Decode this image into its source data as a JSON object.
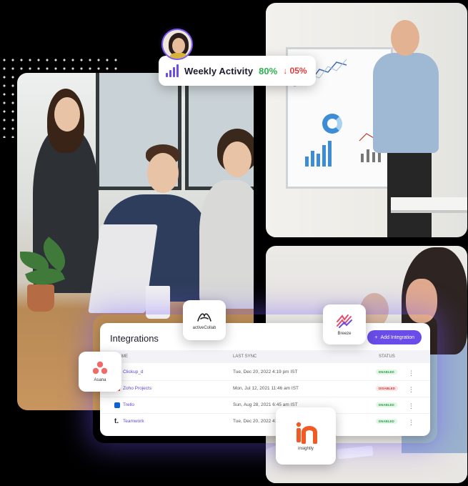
{
  "weekly_activity": {
    "title": "Weekly Activity",
    "percent": "80%",
    "change": "05%",
    "change_icon": "arrow-down-icon"
  },
  "integrations": {
    "title": "Integrations",
    "add_button_label": "Add Integration",
    "columns": [
      "ME",
      "LAST SYNC",
      "STATUS"
    ],
    "rows": [
      {
        "name": "Clickup_d",
        "last_sync": "Tue, Dec 20, 2022 4:19 pm IST",
        "status": "ENABLED"
      },
      {
        "name": "Zoho Projects",
        "last_sync": "Mon, Jul 12, 2021 11:46 am IST",
        "status": "DISABLED"
      },
      {
        "name": "Trello",
        "last_sync": "Sun, Aug 28, 2021 6:45 am IST",
        "status": "ENABLED"
      },
      {
        "name": "Teamwork",
        "last_sync": "Tue, Dec 20, 2022 4:1",
        "status": "ENABLED"
      }
    ]
  },
  "logos": {
    "activecollab": "activeCollab",
    "breeze": "Breeze",
    "asana": "Asana",
    "insightly": "insightly"
  },
  "colors": {
    "accent": "#6a4de8",
    "positive": "#2bb24c",
    "negative": "#e23b3b"
  }
}
